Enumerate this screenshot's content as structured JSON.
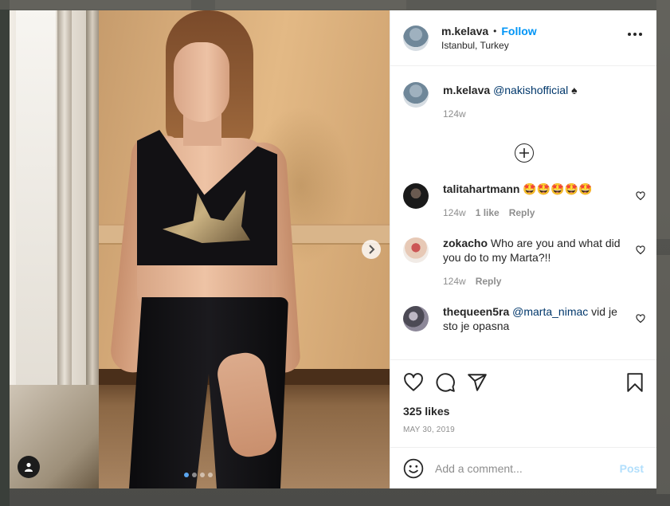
{
  "post": {
    "username": "m.kelava",
    "separator": "•",
    "follow_label": "Follow",
    "location": "Istanbul, Turkey",
    "more_icon": "more-horizontal-icon",
    "next_icon": "chevron-right-icon",
    "user_tag_icon": "user-tag-icon",
    "carousel": {
      "total": 4,
      "active_index": 0
    }
  },
  "caption": {
    "username": "m.kelava",
    "mention": "@nakishofficial",
    "suffix": "♠",
    "time": "124w"
  },
  "load_more_icon": "plus-circle-icon",
  "comments": [
    {
      "username": "talitahartmann",
      "text": "🤩🤩🤩🤩🤩",
      "time": "124w",
      "likes": "1 like",
      "reply": "Reply"
    },
    {
      "username": "zokacho",
      "text": "Who are you and what did you do to my Marta?!!",
      "time": "124w",
      "reply": "Reply"
    },
    {
      "username": "thequeen5ra",
      "mention": "@marta_nimac",
      "text": "vid je sto je opasna"
    }
  ],
  "actions": {
    "like_icon": "heart-icon",
    "comment_icon": "comment-icon",
    "share_icon": "share-icon",
    "save_icon": "bookmark-icon",
    "likes": "325 likes",
    "date": "MAY 30, 2019"
  },
  "add_comment": {
    "emoji_icon": "emoji-icon",
    "placeholder": "Add a comment...",
    "post_label": "Post"
  },
  "colors": {
    "follow": "#0095f6",
    "post_disabled": "#b2dffc",
    "mention": "#00376b",
    "meta": "#8e8e8e",
    "carousel_active": "#5aa5f0"
  }
}
